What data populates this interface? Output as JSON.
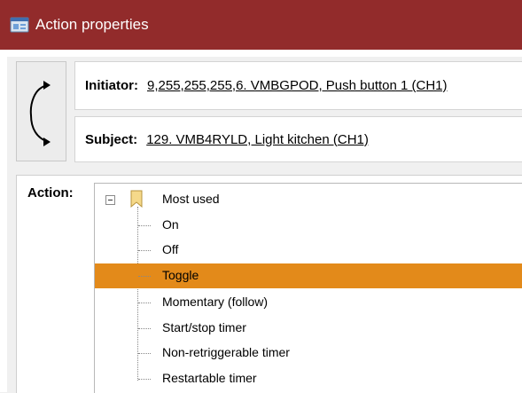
{
  "window": {
    "title": "Action properties"
  },
  "initiator": {
    "label": "Initiator:",
    "value": "9,255,255,255,6. VMBGPOD, Push button 1 (CH1)"
  },
  "subject": {
    "label": "Subject:",
    "value": "129. VMB4RYLD, Light kitchen (CH1)"
  },
  "action": {
    "label": "Action:",
    "group": "Most used",
    "items": [
      "On",
      "Off",
      "Toggle",
      "Momentary (follow)",
      "Start/stop timer",
      "Non-retriggerable timer",
      "Restartable timer"
    ],
    "selected": "Toggle"
  },
  "colors": {
    "titlebar": "#922b2b",
    "selection": "#e38a1a"
  }
}
